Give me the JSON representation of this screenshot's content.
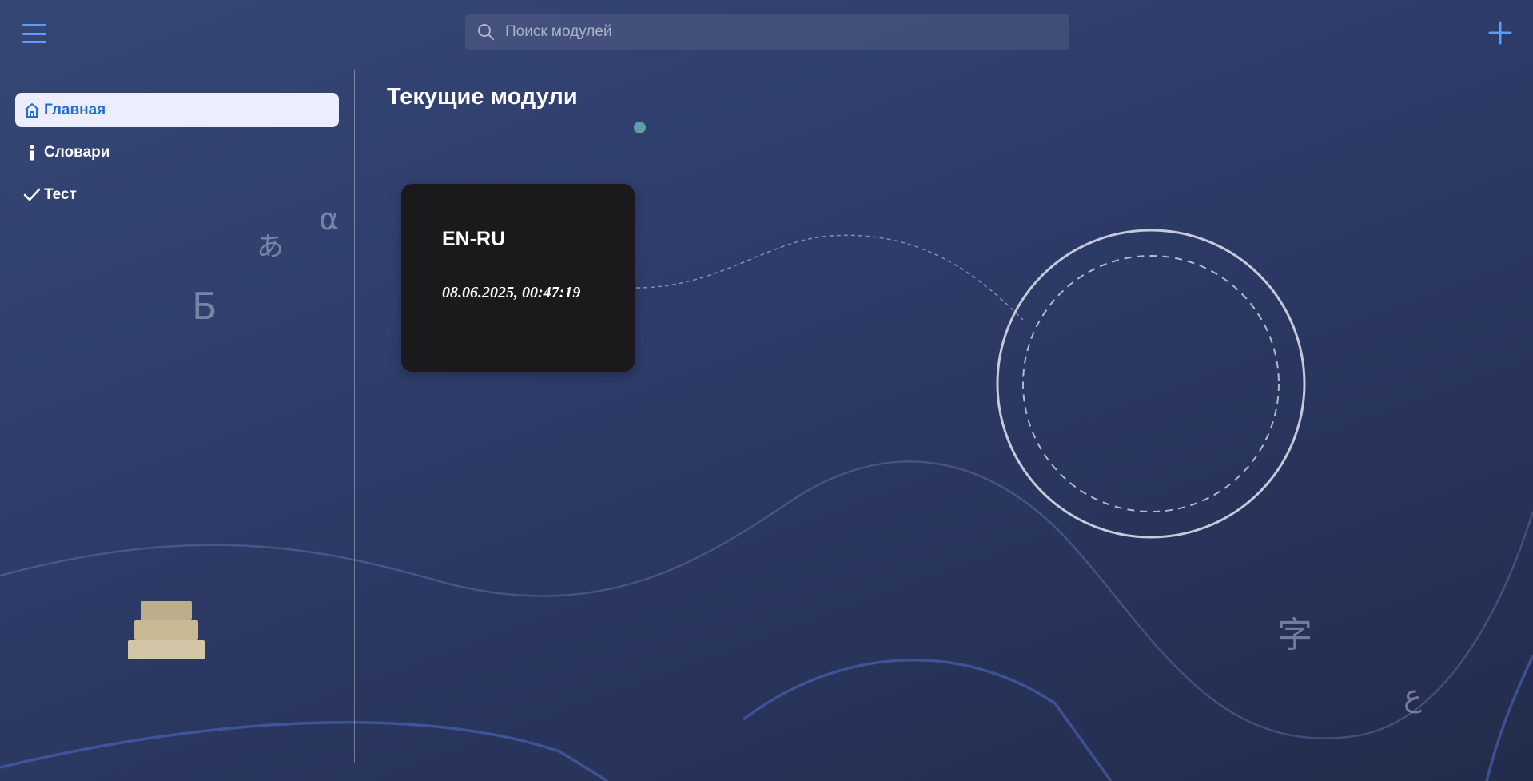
{
  "header": {
    "search_placeholder": "Поиск модулей"
  },
  "sidebar": {
    "items": [
      {
        "label": "Главная",
        "icon": "home-icon",
        "active": true
      },
      {
        "label": "Словари",
        "icon": "info-icon",
        "active": false
      },
      {
        "label": "Тест",
        "icon": "check-icon",
        "active": false
      }
    ]
  },
  "decor": {
    "glyphs": [
      "α",
      "あ",
      "Б",
      "字",
      "ع"
    ]
  },
  "main": {
    "title": "Текущие модули",
    "modules": [
      {
        "name": "EN-RU",
        "date": "08.06.2025, 00:47:19"
      }
    ]
  },
  "colors": {
    "accent": "#5b9dff",
    "active_nav_bg": "#eceeff",
    "active_nav_text": "#1f6fd6",
    "card_bg": "#1a1a1d"
  }
}
